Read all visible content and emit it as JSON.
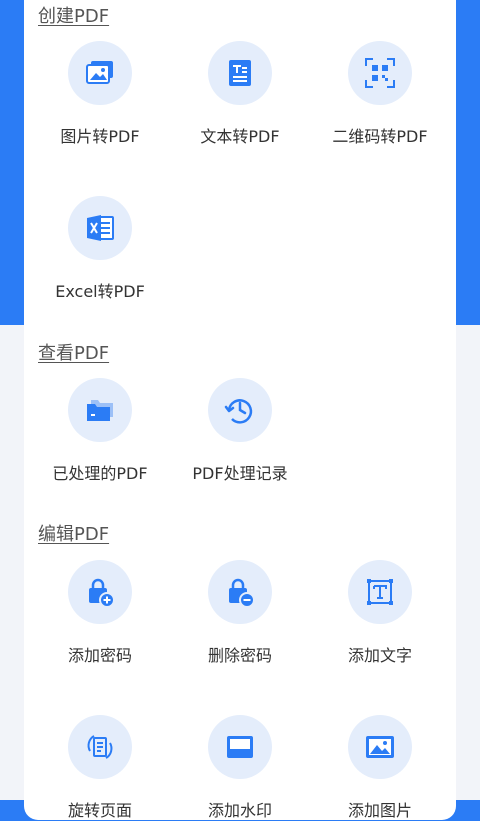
{
  "colors": {
    "brand": "#2b7cf5",
    "icon_bg": "#e4edfb",
    "icon": "#2b7cf5"
  },
  "sections": {
    "create": {
      "title": "创建PDF",
      "tools": [
        {
          "label": "图片转PDF",
          "icon": "image-stack-icon"
        },
        {
          "label": "文本转PDF",
          "icon": "text-doc-icon"
        },
        {
          "label": "二维码转PDF",
          "icon": "qr-code-icon"
        },
        {
          "label": "Excel转PDF",
          "icon": "excel-icon"
        }
      ]
    },
    "view": {
      "title": "查看PDF",
      "tools": [
        {
          "label": "已处理的PDF",
          "icon": "folder-icon"
        },
        {
          "label": "PDF处理记录",
          "icon": "history-clock-icon"
        }
      ]
    },
    "edit": {
      "title": "编辑PDF",
      "tools": [
        {
          "label": "添加密码",
          "icon": "lock-add-icon"
        },
        {
          "label": "删除密码",
          "icon": "lock-remove-icon"
        },
        {
          "label": "添加文字",
          "icon": "text-frame-icon"
        },
        {
          "label": "旋转页面",
          "icon": "rotate-page-icon"
        },
        {
          "label": "添加水印",
          "icon": "watermark-icon"
        },
        {
          "label": "添加图片",
          "icon": "add-image-icon"
        }
      ]
    }
  }
}
